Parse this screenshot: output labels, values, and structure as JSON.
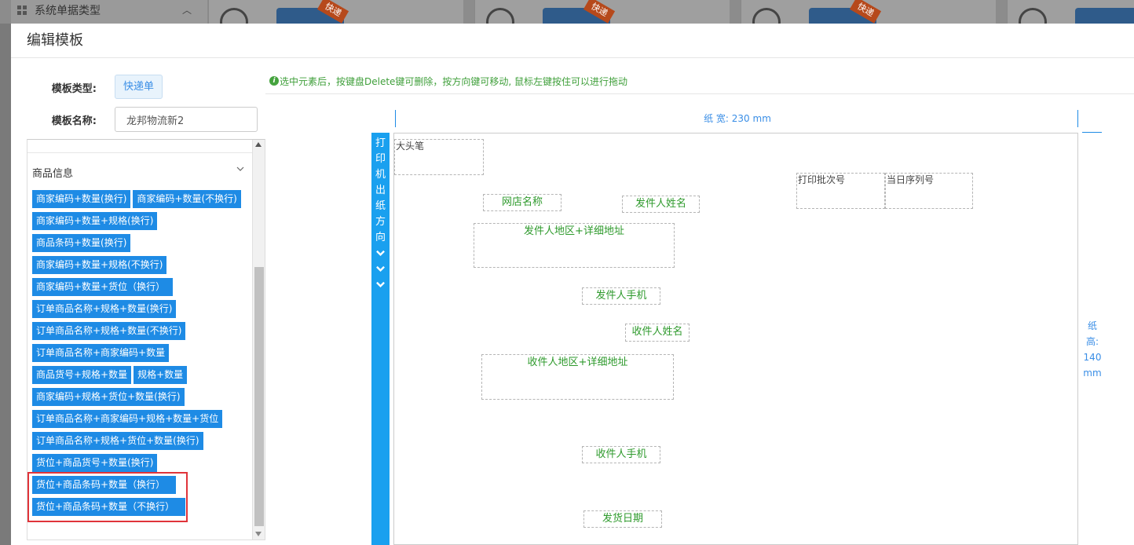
{
  "background": {
    "nav_label": "系统单据类型",
    "card_tag": "快递"
  },
  "modal": {
    "title": "编辑模板"
  },
  "form": {
    "type_label": "模板类型:",
    "type_value": "快递单",
    "name_label": "模板名称:",
    "name_value": "龙邦物流新2"
  },
  "section": {
    "title": "商品信息",
    "chip_rows": [
      [
        "商家编码+数量(换行)",
        "商家编码+数量(不换行)"
      ],
      [
        "商家编码+数量+规格(换行)"
      ],
      [
        "商品条码+数量(换行)"
      ],
      [
        "商家编码+数量+规格(不换行)"
      ],
      [
        "商家编码+数量+货位（换行）"
      ],
      [
        "订单商品名称+规格+数量(换行)"
      ],
      [
        "订单商品名称+规格+数量(不换行)"
      ],
      [
        "订单商品名称+商家编码+数量"
      ],
      [
        "商品货号+规格+数量",
        "规格+数量"
      ],
      [
        "商家编码+规格+货位+数量(换行)"
      ],
      [
        "订单商品名称+商家编码+规格+数量+货位"
      ],
      [
        "订单商品名称+规格+货位+数量(换行)"
      ],
      [
        "货位+商品货号+数量(换行)"
      ],
      [
        "货位+商品条码+数量（换行）"
      ],
      [
        "货位+商品条码+数量（不换行）"
      ]
    ]
  },
  "editor": {
    "tip": "选中元素后，按键盘Delete键可删除，按方向键可移动, 鼠标左键按住可以进行拖动",
    "paper_width": "纸 宽: 230 mm",
    "paper_height_lines": [
      "纸",
      "高:",
      "140",
      "mm"
    ],
    "direction_chars": [
      "打",
      "印",
      "机",
      "出",
      "纸",
      "方",
      "向"
    ],
    "fields": {
      "dtb": "大头笔",
      "batch": "打印批次号",
      "seq": "当日序列号",
      "shop": "网店名称",
      "sender_name": "发件人姓名",
      "sender_addr": "发件人地区+详细地址",
      "sender_phone": "发件人手机",
      "recv_name": "收件人姓名",
      "recv_addr": "收件人地区+详细地址",
      "recv_phone": "收件人手机",
      "ship_date": "发货日期"
    }
  }
}
